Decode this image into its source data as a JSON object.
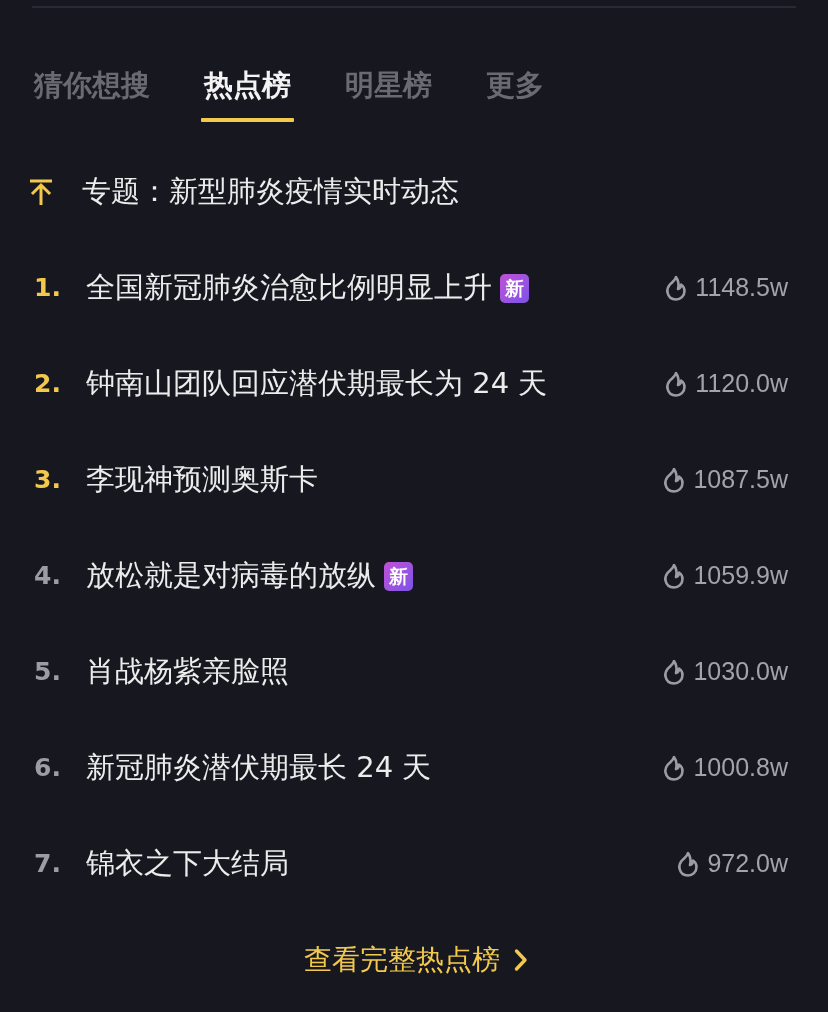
{
  "tabs": [
    {
      "label": "猜你想搜",
      "selected": false
    },
    {
      "label": "热点榜",
      "selected": true
    },
    {
      "label": "明星榜",
      "selected": false
    },
    {
      "label": "更多",
      "selected": false
    }
  ],
  "pinned_topic": {
    "label": "专题：新型肺炎疫情实时动态"
  },
  "hot_list": [
    {
      "rank": "1.",
      "highlighted": true,
      "title": "全国新冠肺炎治愈比例明显上升",
      "badge": "新",
      "heat": "1148.5w"
    },
    {
      "rank": "2.",
      "highlighted": true,
      "title": "钟南山团队回应潜伏期最长为 24 天",
      "heat": "1120.0w"
    },
    {
      "rank": "3.",
      "highlighted": true,
      "title": "李现神预测奥斯卡",
      "heat": "1087.5w"
    },
    {
      "rank": "4.",
      "highlighted": false,
      "title": "放松就是对病毒的放纵",
      "badge": "新",
      "heat": "1059.9w"
    },
    {
      "rank": "5.",
      "highlighted": false,
      "title": "肖战杨紫亲脸照",
      "heat": "1030.0w"
    },
    {
      "rank": "6.",
      "highlighted": false,
      "title": "新冠肺炎潜伏期最长 24 天",
      "heat": "1000.8w"
    },
    {
      "rank": "7.",
      "highlighted": false,
      "title": "锦衣之下大结局",
      "heat": "972.0w"
    }
  ],
  "footer_link": {
    "label": "查看完整热点榜"
  }
}
